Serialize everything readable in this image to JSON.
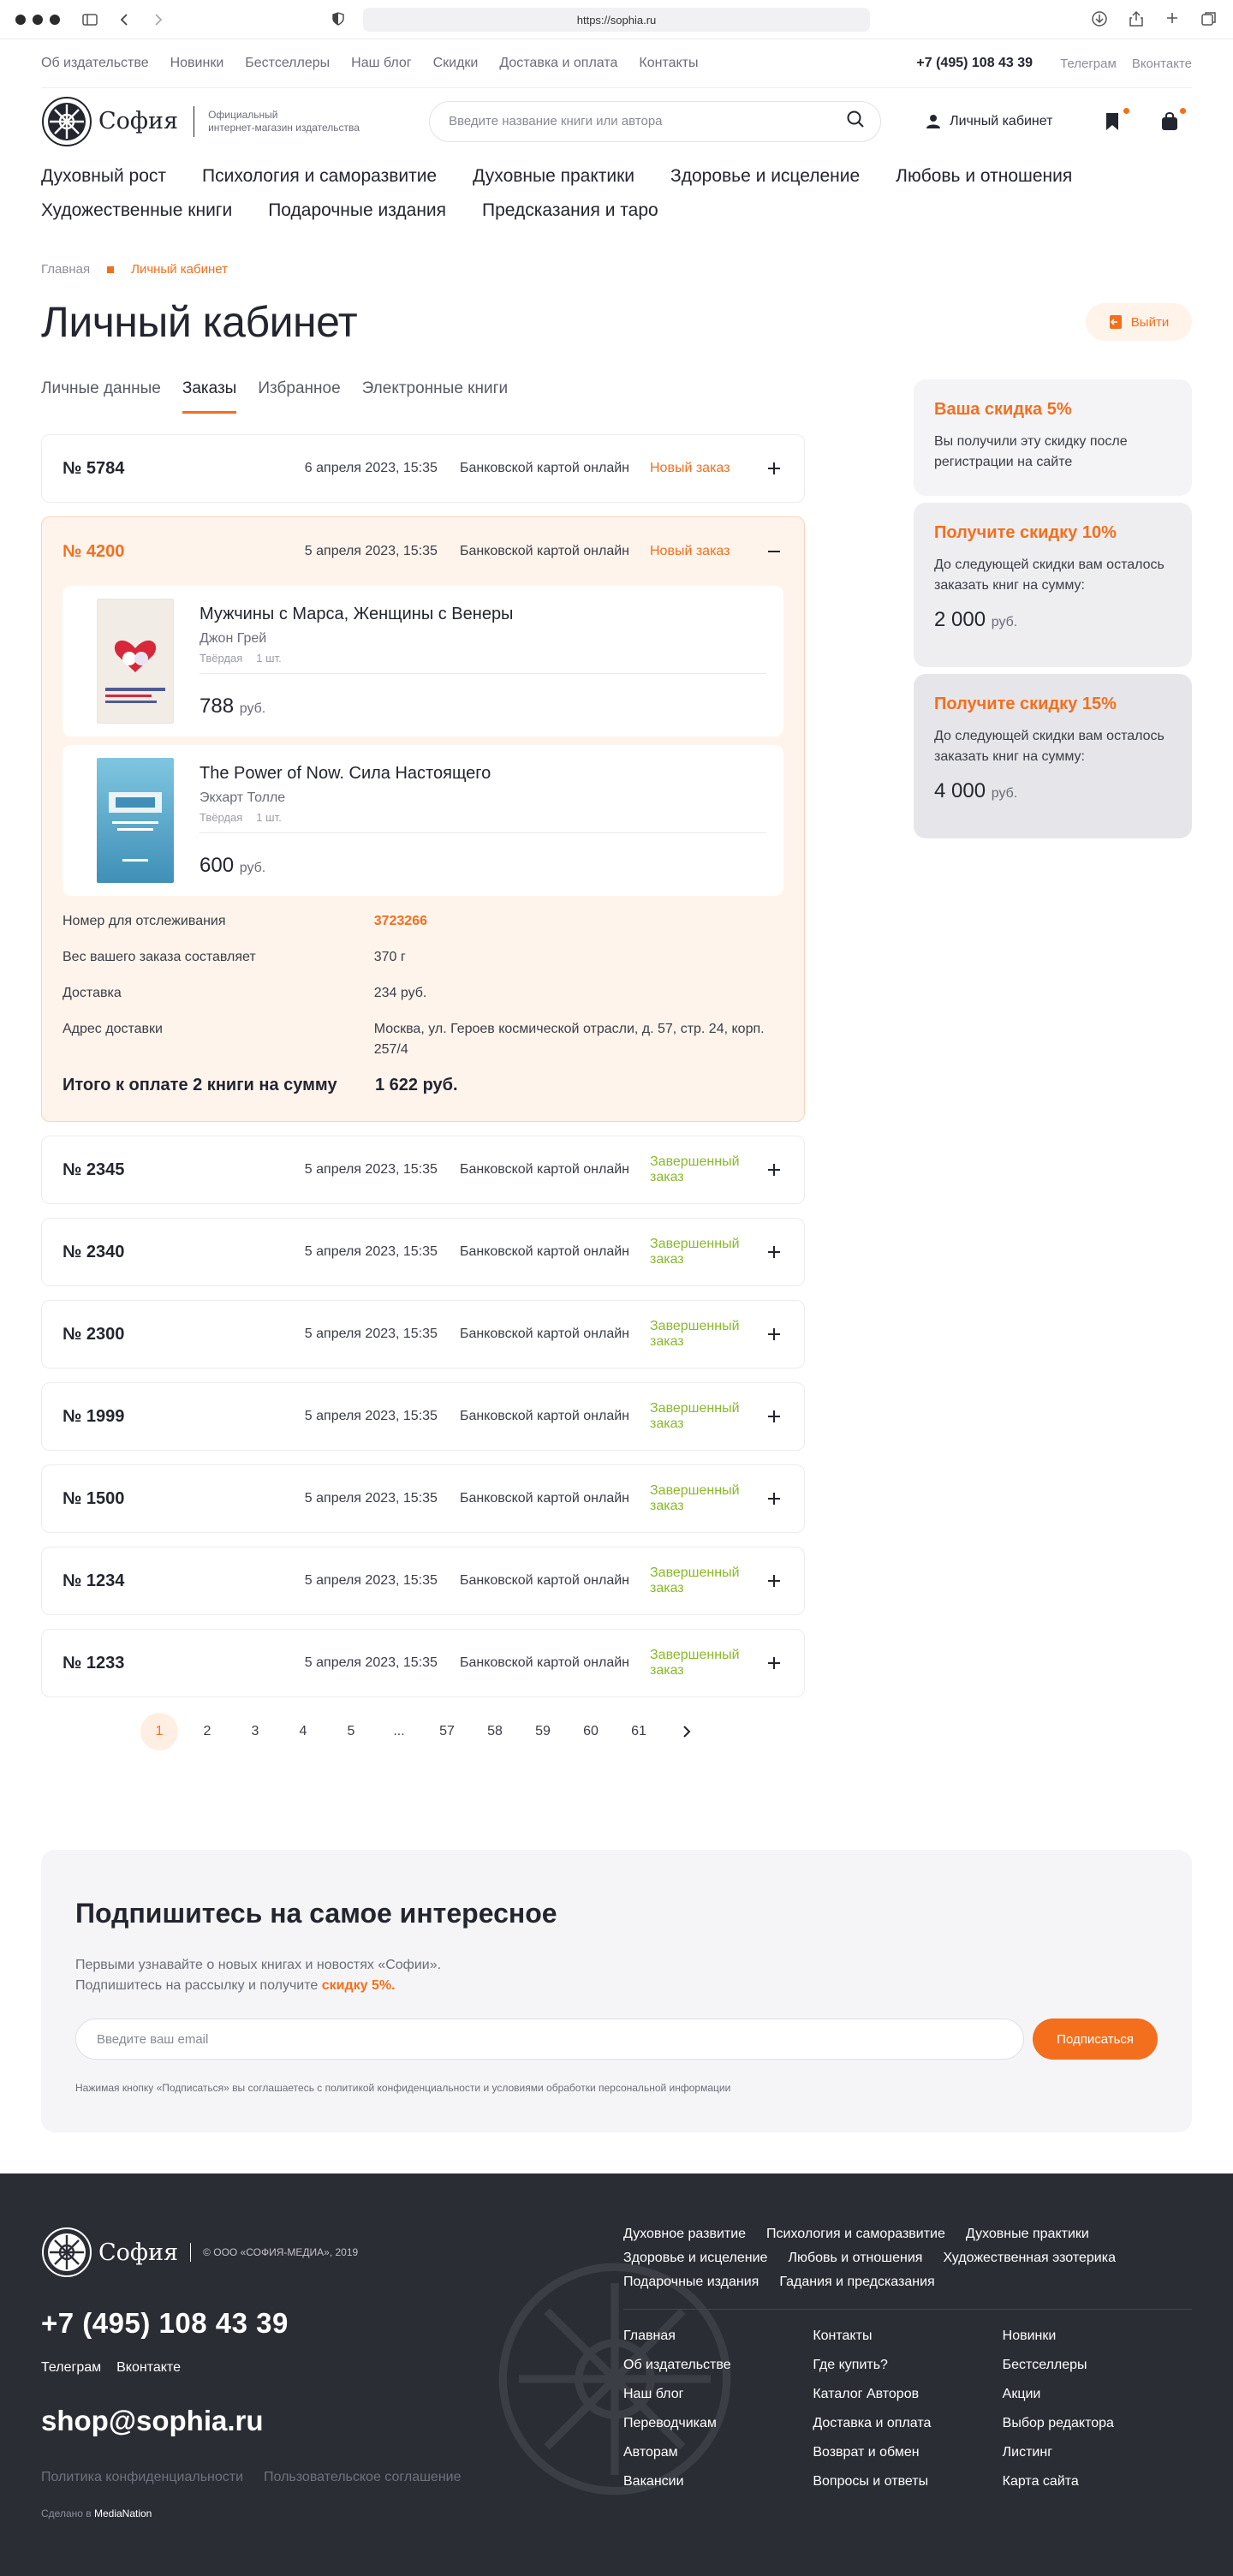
{
  "browser": {
    "url": "https://sophia.ru"
  },
  "topbar": {
    "links": [
      "Об издательстве",
      "Новинки",
      "Бестселлеры",
      "Наш блог",
      "Скидки",
      "Доставка и оплата",
      "Контакты"
    ],
    "phone": "+7 (495) 108 43 39",
    "social": [
      "Телеграм",
      "Вконтакте"
    ]
  },
  "header": {
    "logo_text": "София",
    "logo_sub_1": "Официальный",
    "logo_sub_2": "интернет-магазин издательства",
    "search_placeholder": "Введите название книги или автора",
    "account_label": "Личный кабинет"
  },
  "categories": [
    "Духовный рост",
    "Психология и саморазвитие",
    "Духовные практики",
    "Здоровье и исцеление",
    "Любовь и отношения",
    "Художественные книги",
    "Подарочные издания",
    "Предсказания и таро"
  ],
  "breadcrumbs": {
    "home": "Главная",
    "current": "Личный кабинет"
  },
  "page": {
    "title": "Личный кабинет",
    "logout": "Выйти"
  },
  "tabs": [
    "Личные данные",
    "Заказы",
    "Избранное",
    "Электронные книги"
  ],
  "orders": {
    "first": {
      "num": "№ 5784",
      "date": "6 апреля 2023, 15:35",
      "pay": "Банковской картой онлайн",
      "status": "Новый заказ"
    },
    "open": {
      "num": "№ 4200",
      "date": "5 апреля 2023, 15:35",
      "pay": "Банковской картой онлайн",
      "status": "Новый заказ",
      "books": [
        {
          "title": "Мужчины с Марса, Женщины с Венеры",
          "author": "Джон Грей",
          "binding": "Твёрдая",
          "qty": "1 шт.",
          "price": "788",
          "currency": "руб."
        },
        {
          "title": "The Power of Now. Сила Настоящего",
          "author": "Экхарт Толле",
          "binding": "Твёрдая",
          "qty": "1 шт.",
          "price": "600",
          "currency": "руб."
        }
      ],
      "details": [
        {
          "label": "Номер для отслеживания",
          "value": "3723266"
        },
        {
          "label": "Вес вашего заказа составляет",
          "value": "370 г"
        },
        {
          "label": "Доставка",
          "value": "234 руб."
        },
        {
          "label": "Адрес доставки",
          "value": "Москва, ул. Героев космической отрасли, д. 57, стр. 24, корп. 257/4"
        }
      ],
      "total_label": "Итого к оплате 2 книги на сумму",
      "total_value": "1 622 руб."
    },
    "rest": [
      {
        "num": "№ 2345",
        "date": "5 апреля 2023, 15:35",
        "pay": "Банковской картой онлайн",
        "status": "Завершенный заказ"
      },
      {
        "num": "№ 2340",
        "date": "5 апреля 2023, 15:35",
        "pay": "Банковской картой онлайн",
        "status": "Завершенный заказ"
      },
      {
        "num": "№ 2300",
        "date": "5 апреля 2023, 15:35",
        "pay": "Банковской картой онлайн",
        "status": "Завершенный заказ"
      },
      {
        "num": "№ 1999",
        "date": "5 апреля 2023, 15:35",
        "pay": "Банковской картой онлайн",
        "status": "Завершенный заказ"
      },
      {
        "num": "№ 1500",
        "date": "5 апреля 2023, 15:35",
        "pay": "Банковской картой онлайн",
        "status": "Завершенный заказ"
      },
      {
        "num": "№ 1234",
        "date": "5 апреля 2023, 15:35",
        "pay": "Банковской картой онлайн",
        "status": "Завершенный заказ"
      },
      {
        "num": "№ 1233",
        "date": "5 апреля 2023, 15:35",
        "pay": "Банковской картой онлайн",
        "status": "Завершенный заказ"
      }
    ]
  },
  "pagination": [
    "1",
    "2",
    "3",
    "4",
    "5",
    "...",
    "57",
    "58",
    "59",
    "60",
    "61"
  ],
  "discounts": [
    {
      "title": "Ваша скидка 5%",
      "text": "Вы получили эту скидку после регистрации на сайте",
      "amount": "",
      "currency": ""
    },
    {
      "title": "Получите скидку 10%",
      "text": "До следующей скидки вам осталось заказать книг на сумму:",
      "amount": "2 000",
      "currency": "руб."
    },
    {
      "title": "Получите скидку 15%",
      "text": "До следующей скидки вам осталось заказать книг на сумму:",
      "amount": "4 000",
      "currency": "руб."
    }
  ],
  "subscribe": {
    "title": "Подпишитесь на самое интересное",
    "line1": "Первыми узнавайте о новых книгах и новостях «Софии».",
    "line2": "Подпишитесь на рассылку и получите",
    "accent": "скидку 5%.",
    "placeholder": "Введите ваш email",
    "button": "Подписаться",
    "note": "Нажимая кнопку «Подписаться» вы соглашаетесь с политикой конфиденциальности и условиями обработки персональной информации"
  },
  "footer": {
    "copy": "© ООО «СОФИЯ-МЕДИА», 2019",
    "phone": "+7 (495) 108 43 39",
    "social": [
      "Телеграм",
      "Вконтакте"
    ],
    "email": "shop@sophia.ru",
    "legal": [
      "Политика конфиденциальности",
      "Пользовательское соглашение"
    ],
    "made_by_label": "Сделано в",
    "made_by": "MediaNation",
    "cats": [
      "Духовное развитие",
      "Психология и саморазвитие",
      "Духовные практики",
      "Здоровье и исцеление",
      "Любовь и отношения",
      "Художественная эзотерика",
      "Подарочные издания",
      "Гадания и предсказания"
    ],
    "col1": [
      "Главная",
      "Об издательстве",
      "Наш блог",
      "Переводчикам",
      "Авторам",
      "Вакансии"
    ],
    "col2": [
      "Контакты",
      "Где купить?",
      "Каталог Авторов",
      "Доставка и оплата",
      "Возврат и обмен",
      "Вопросы и ответы"
    ],
    "col3": [
      "Новинки",
      "Бестселлеры",
      "Акции",
      "Выбор редактора",
      "Листинг",
      "Карта сайта"
    ]
  },
  "colors": {
    "accent": "#f36f1d",
    "done": "#8ab82a",
    "footer": "#2b2d35"
  }
}
